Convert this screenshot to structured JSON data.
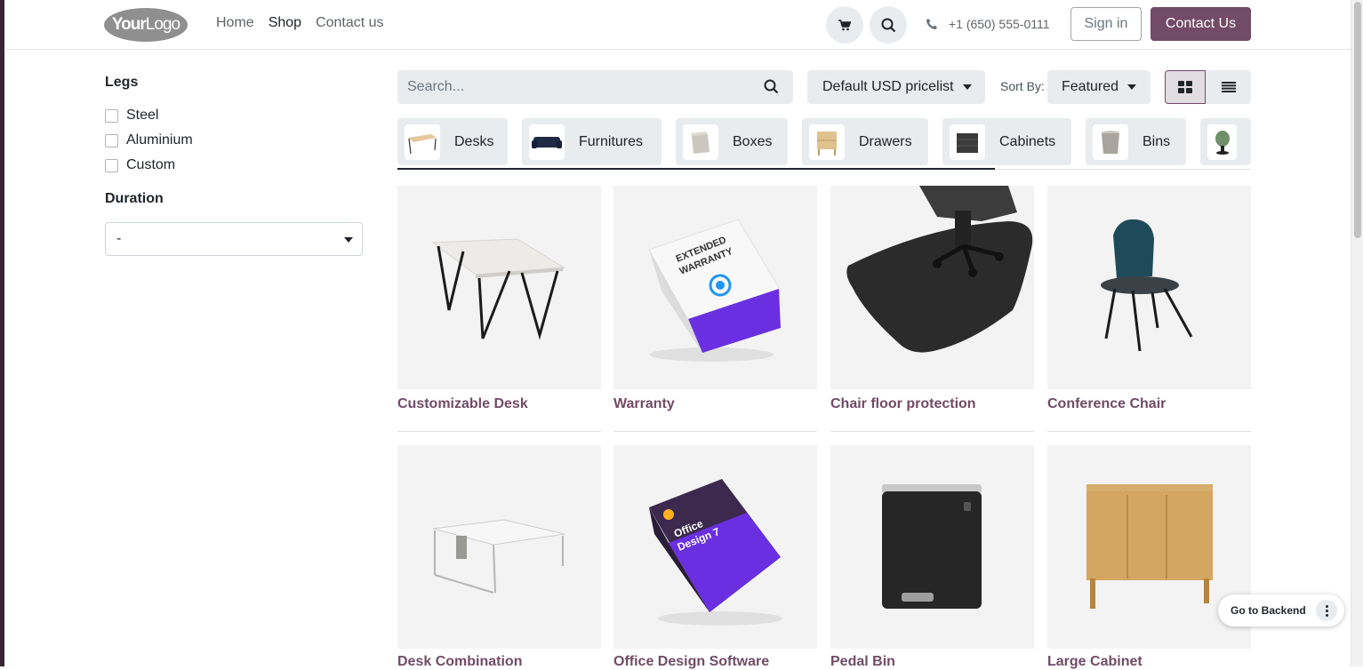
{
  "header": {
    "logo_text_bold": "Your",
    "logo_text": "Logo",
    "nav": [
      "Home",
      "Shop",
      "Contact us"
    ],
    "phone": "+1 (650) 555-0111",
    "signin_label": "Sign in",
    "contact_label": "Contact Us"
  },
  "sidebar": {
    "legs_title": "Legs",
    "legs_options": [
      "Steel",
      "Aluminium",
      "Custom"
    ],
    "duration_title": "Duration",
    "duration_value": "-"
  },
  "toolbar": {
    "search_placeholder": "Search...",
    "pricelist_label": "Default USD pricelist",
    "sortby_label": "Sort By:",
    "sortby_value": "Featured"
  },
  "categories": [
    "Desks",
    "Furnitures",
    "Boxes",
    "Drawers",
    "Cabinets",
    "Bins"
  ],
  "products": [
    "Customizable Desk",
    "Warranty",
    "Chair floor protection",
    "Conference Chair",
    "Desk Combination",
    "Office Design Software",
    "Pedal Bin",
    "Large Cabinet"
  ],
  "product_art_text": {
    "warranty_box": "EXTENDED WARRANTY",
    "software_box": "Office Design 7"
  },
  "floating": {
    "backend_label": "Go to Backend"
  },
  "colors": {
    "brand": "#714b67",
    "button_bg": "#e9ecef"
  }
}
